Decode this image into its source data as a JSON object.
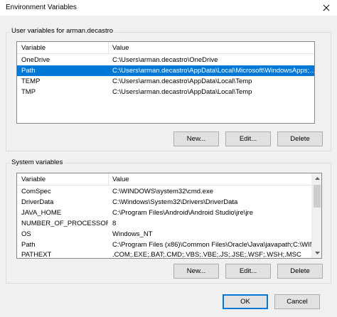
{
  "window": {
    "title": "Environment Variables"
  },
  "user_vars": {
    "group_label": "User variables for arman.decastro",
    "columns": [
      "Variable",
      "Value"
    ],
    "rows": [
      {
        "name": "OneDrive",
        "value": "C:\\Users\\arman.decastro\\OneDrive"
      },
      {
        "name": "Path",
        "value": "C:\\Users\\arman.decastro\\AppData\\Local\\Microsoft\\WindowsApps;..."
      },
      {
        "name": "TEMP",
        "value": "C:\\Users\\arman.decastro\\AppData\\Local\\Temp"
      },
      {
        "name": "TMP",
        "value": "C:\\Users\\arman.decastro\\AppData\\Local\\Temp"
      }
    ],
    "buttons": {
      "new": "New...",
      "edit": "Edit...",
      "delete": "Delete"
    }
  },
  "system_vars": {
    "group_label": "System variables",
    "columns": [
      "Variable",
      "Value"
    ],
    "rows": [
      {
        "name": "ComSpec",
        "value": "C:\\WINDOWS\\system32\\cmd.exe"
      },
      {
        "name": "DriverData",
        "value": "C:\\Windows\\System32\\Drivers\\DriverData"
      },
      {
        "name": "JAVA_HOME",
        "value": "C:\\Program Files\\Android\\Android Studio\\jre\\jre"
      },
      {
        "name": "NUMBER_OF_PROCESSORS",
        "value": "8"
      },
      {
        "name": "OS",
        "value": "Windows_NT"
      },
      {
        "name": "Path",
        "value": "C:\\Program Files (x86)\\Common Files\\Oracle\\Java\\javapath;C:\\WIN..."
      },
      {
        "name": "PATHEXT",
        "value": ".COM;.EXE;.BAT;.CMD;.VBS;.VBE;.JS;.JSE;.WSF;.WSH;.MSC"
      }
    ],
    "buttons": {
      "new": "New...",
      "edit": "Edit...",
      "delete": "Delete"
    }
  },
  "dialog_buttons": {
    "ok": "OK",
    "cancel": "Cancel"
  },
  "colors": {
    "selection": "#0078d7",
    "focus_border": "#0078d7"
  }
}
